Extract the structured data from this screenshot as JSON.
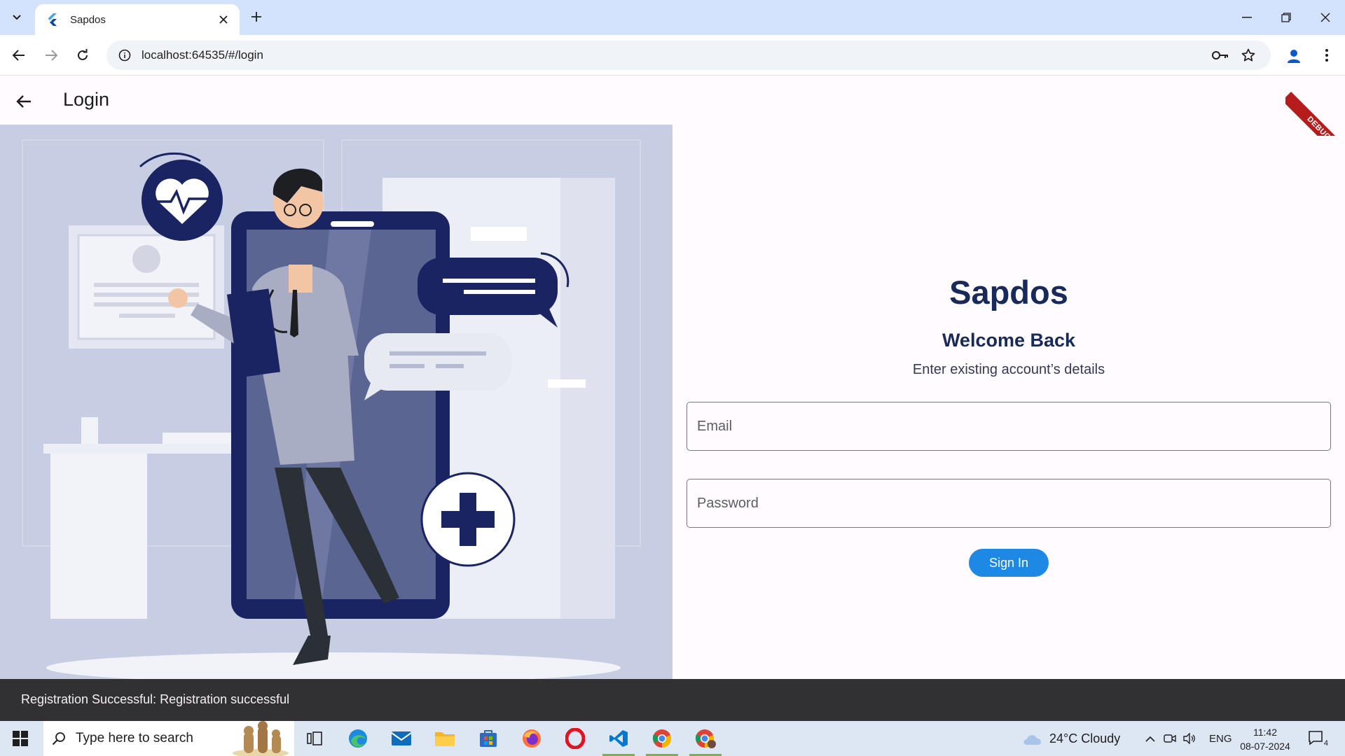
{
  "browser": {
    "tab_title": "Sapdos",
    "url": "localhost:64535/#/login"
  },
  "app": {
    "title": "Login",
    "debug_banner": "DEBUG"
  },
  "login": {
    "brand": "Sapdos",
    "welcome": "Welcome Back",
    "subtitle": "Enter existing account’s details",
    "email_placeholder": "Email",
    "password_placeholder": "Password",
    "signin_label": "Sign In"
  },
  "snackbar": {
    "message": "Registration Successful: Registration successful"
  },
  "taskbar": {
    "search_placeholder": "Type here to search",
    "weather": "24°C  Cloudy",
    "language": "ENG",
    "time": "11:42",
    "date": "08-07-2024",
    "notification_count": "4"
  },
  "colors": {
    "brand": "#172a5a",
    "button": "#1e88e5",
    "illustration_bg": "#c7cee3",
    "navy": "#1a2463",
    "snackbar": "#313033"
  }
}
